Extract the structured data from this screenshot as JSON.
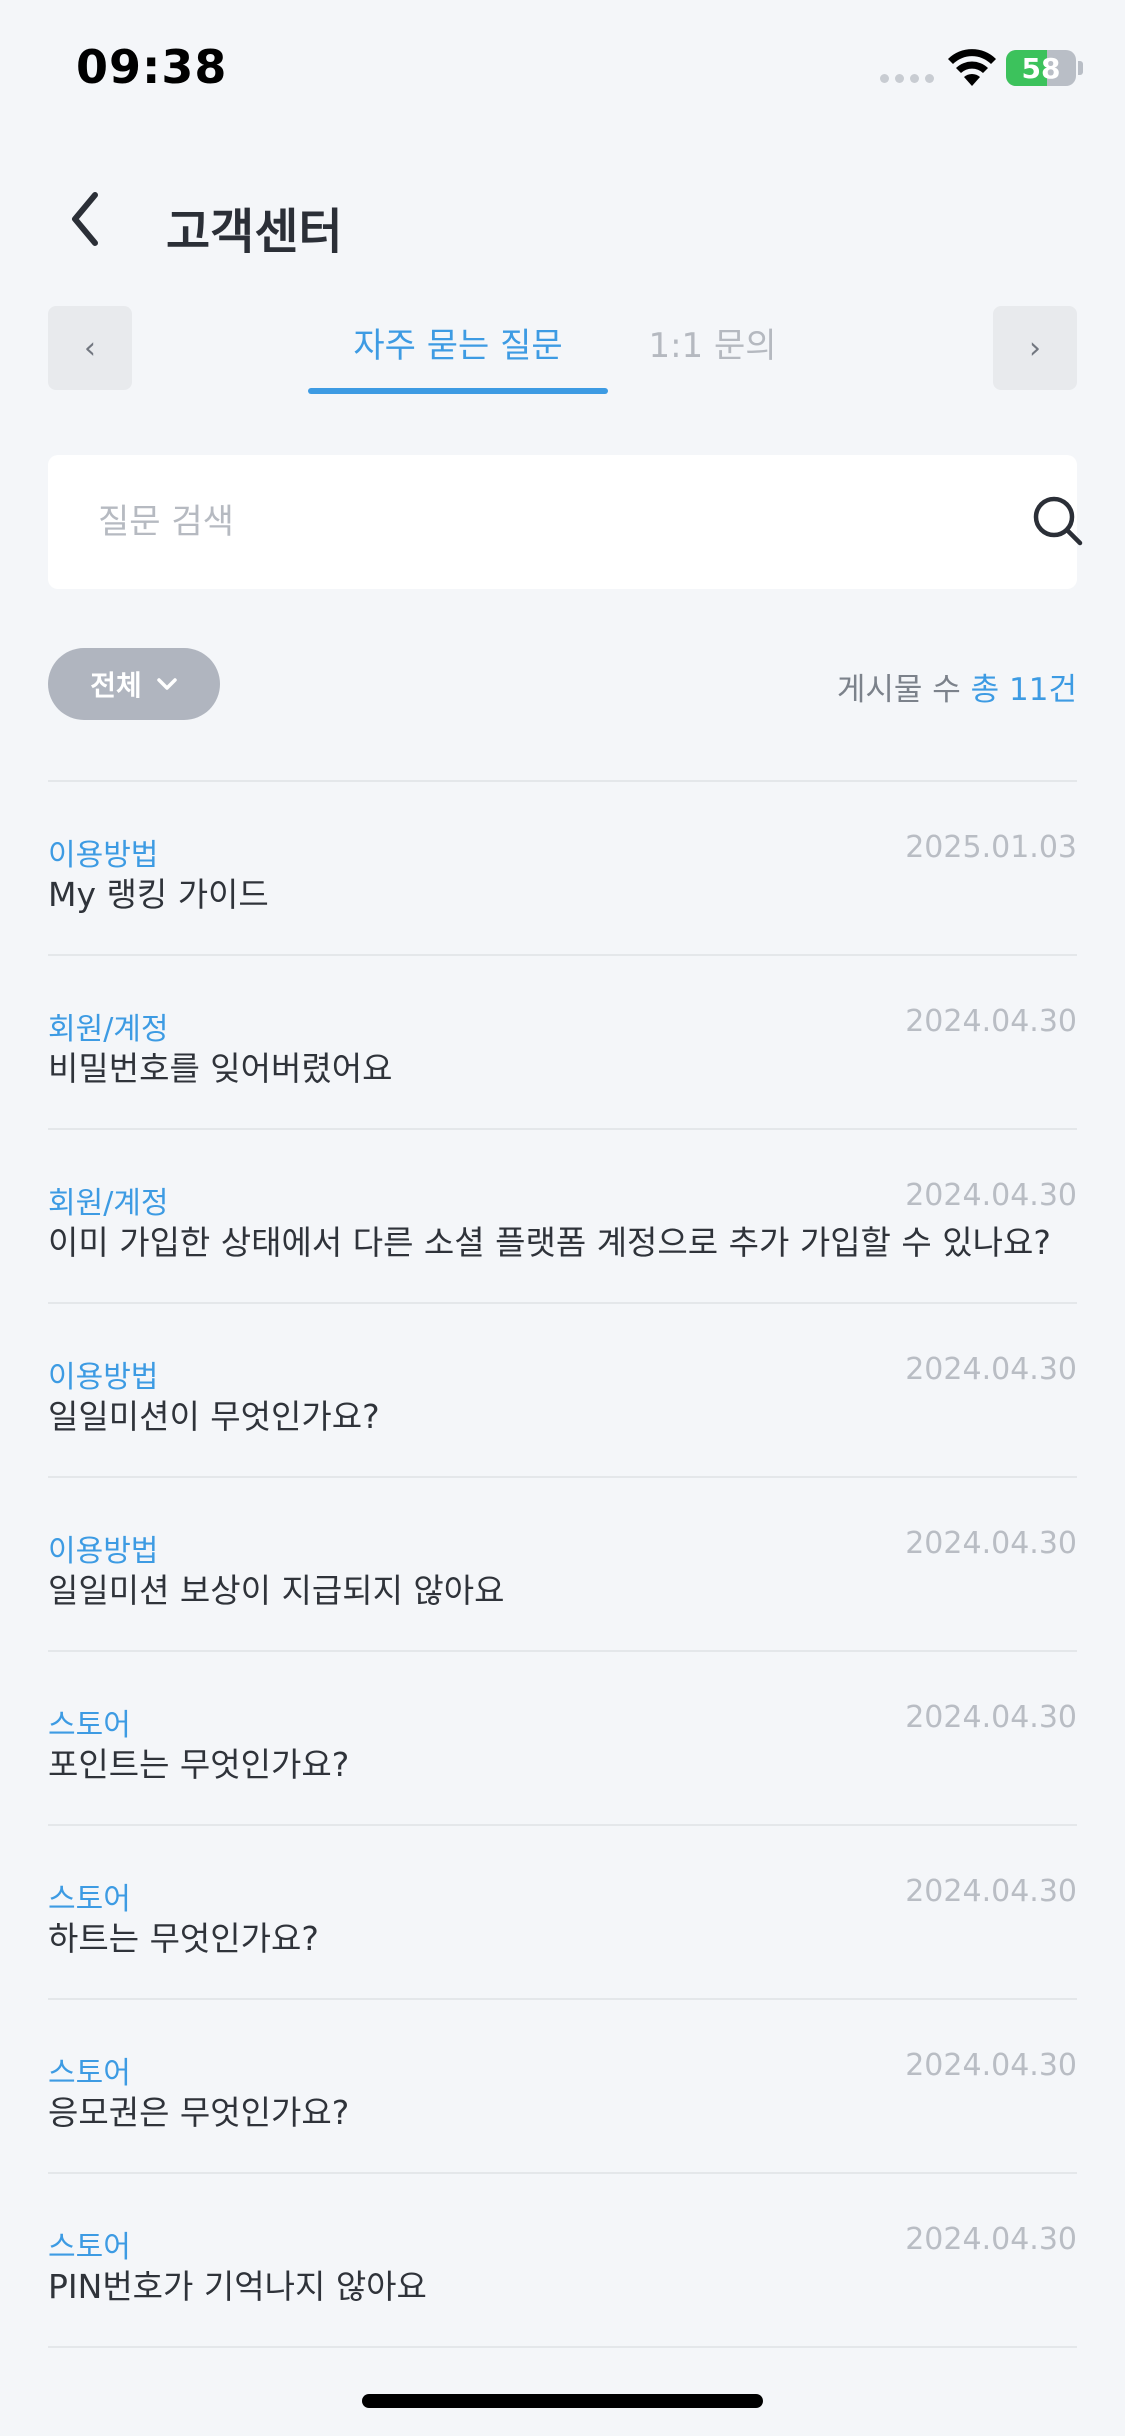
{
  "status_bar": {
    "time": "09:38",
    "battery": "58",
    "battery_level": 0.58
  },
  "header": {
    "title": "고객센터",
    "back_icon": "chevron-left-icon"
  },
  "tabs": {
    "prev_label": "‹",
    "next_label": "›",
    "items": [
      {
        "label": "자주 묻는 질문",
        "active": true
      },
      {
        "label": "1:1 문의",
        "active": false
      }
    ]
  },
  "search": {
    "placeholder": "질문 검색",
    "value": "",
    "icon": "search-icon"
  },
  "filter": {
    "selected": "전체",
    "icon": "chevron-down-icon"
  },
  "post_count": {
    "label": "게시물 수",
    "value": "총 11건"
  },
  "faq_items": [
    {
      "category": "이용방법",
      "question": "My 랭킹 가이드",
      "date": "2025.01.03"
    },
    {
      "category": "회원/계정",
      "question": "비밀번호를 잊어버렸어요",
      "date": "2024.04.30"
    },
    {
      "category": "회원/계정",
      "question": "이미 가입한 상태에서 다른 소셜 플랫폼 계정으로 추가 가입할 수 있나요?",
      "date": "2024.04.30"
    },
    {
      "category": "이용방법",
      "question": "일일미션이 무엇인가요?",
      "date": "2024.04.30"
    },
    {
      "category": "이용방법",
      "question": "일일미션 보상이 지급되지 않아요",
      "date": "2024.04.30"
    },
    {
      "category": "스토어",
      "question": "포인트는 무엇인가요?",
      "date": "2024.04.30"
    },
    {
      "category": "스토어",
      "question": "하트는 무엇인가요?",
      "date": "2024.04.30"
    },
    {
      "category": "스토어",
      "question": "응모권은 무엇인가요?",
      "date": "2024.04.30"
    },
    {
      "category": "스토어",
      "question": "PIN번호가 기억나지 않아요",
      "date": "2024.04.30"
    }
  ],
  "colors": {
    "accent": "#3d9be3",
    "background": "#f4f6f9",
    "chip": "#b0b5bf",
    "battery": "#3cc25c"
  }
}
